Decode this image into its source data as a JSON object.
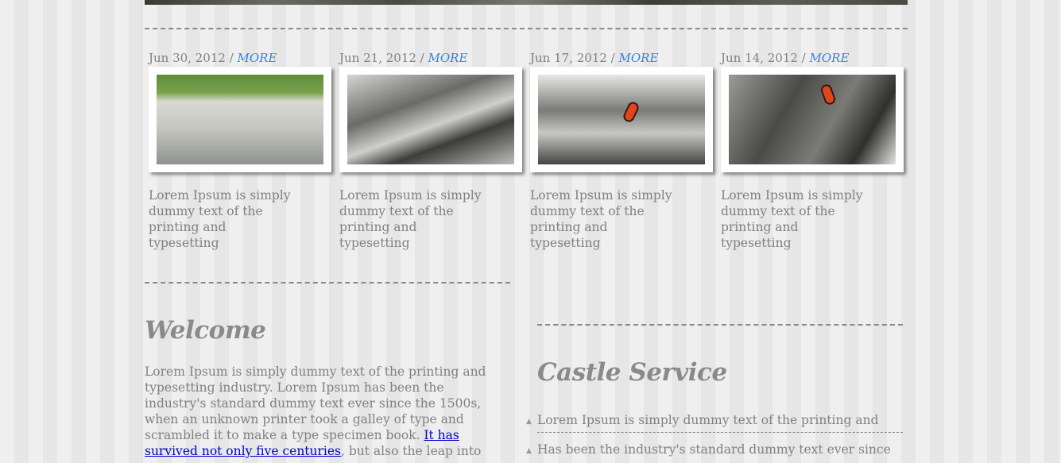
{
  "posts": [
    {
      "date": "Jun 30, 2012 /",
      "more": "MORE",
      "text": "Lorem Ipsum is simply dummy text of the printing and typesetting"
    },
    {
      "date": "Jun 21, 2012 /",
      "more": "MORE",
      "text": "Lorem Ipsum is simply dummy text of the printing and typesetting"
    },
    {
      "date": "Jun 17, 2012 /",
      "more": "MORE",
      "text": "Lorem Ipsum is simply dummy text of the printing and typesetting"
    },
    {
      "date": "Jun 14, 2012 /",
      "more": "MORE",
      "text": "Lorem Ipsum is simply dummy text of the printing and typesetting"
    }
  ],
  "welcome": {
    "title": "Welcome",
    "text_before": "Lorem Ipsum is simply dummy text of the printing and typesetting industry. Lorem Ipsum has been the industry's standard dummy text ever since the 1500s, when an unknown printer took a galley of type and scrambled it to make a type specimen book. ",
    "link": "It has survived not only five centuries",
    "text_after": ", but also the leap into"
  },
  "service": {
    "title": "Castle Service",
    "items": [
      "Lorem Ipsum is simply dummy text of the printing and",
      "Has been the industry's standard dummy text ever since"
    ]
  },
  "colors": {
    "link": "#3d7fdd",
    "text": "#808080",
    "hyperlink": "#0000cc"
  }
}
